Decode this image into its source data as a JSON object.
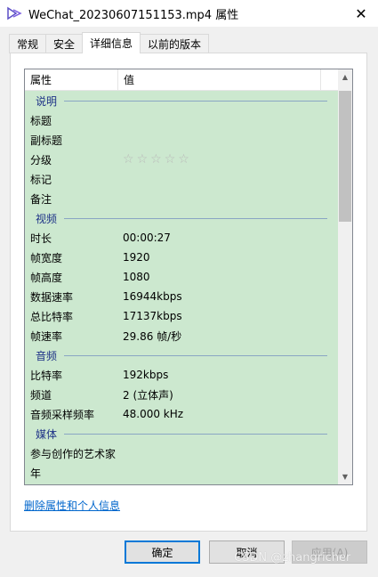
{
  "window": {
    "title": "WeChat_20230607151153.mp4 属性",
    "close_label": "✕"
  },
  "tabs": [
    {
      "label": "常规",
      "active": false
    },
    {
      "label": "安全",
      "active": false
    },
    {
      "label": "详细信息",
      "active": true
    },
    {
      "label": "以前的版本",
      "active": false
    }
  ],
  "list": {
    "header": {
      "property": "属性",
      "value": "值"
    },
    "groups": [
      {
        "name": "说明",
        "rows": [
          {
            "key": "标题",
            "value": ""
          },
          {
            "key": "副标题",
            "value": ""
          },
          {
            "key": "分级",
            "value": "",
            "rating": 0,
            "rating_max": 5
          },
          {
            "key": "标记",
            "value": ""
          },
          {
            "key": "备注",
            "value": ""
          }
        ]
      },
      {
        "name": "视频",
        "rows": [
          {
            "key": "时长",
            "value": "00:00:27"
          },
          {
            "key": "帧宽度",
            "value": "1920"
          },
          {
            "key": "帧高度",
            "value": "1080"
          },
          {
            "key": "数据速率",
            "value": "16944kbps"
          },
          {
            "key": "总比特率",
            "value": "17137kbps"
          },
          {
            "key": "帧速率",
            "value": "29.86 帧/秒"
          }
        ]
      },
      {
        "name": "音频",
        "rows": [
          {
            "key": "比特率",
            "value": "192kbps"
          },
          {
            "key": "频道",
            "value": "2 (立体声)"
          },
          {
            "key": "音频采样频率",
            "value": "48.000 kHz"
          }
        ]
      },
      {
        "name": "媒体",
        "rows": [
          {
            "key": "参与创作的艺术家",
            "value": ""
          },
          {
            "key": "年",
            "value": ""
          }
        ]
      }
    ]
  },
  "link": {
    "label": "删除属性和个人信息"
  },
  "buttons": {
    "ok": "确定",
    "cancel": "取消",
    "apply": "应用(A)"
  },
  "watermark": "CSDN @zhangricher",
  "colors": {
    "row_background": "#cce8cf",
    "group_text": "#1e3287",
    "link": "#0066cc",
    "ok_border": "#0078d7"
  }
}
